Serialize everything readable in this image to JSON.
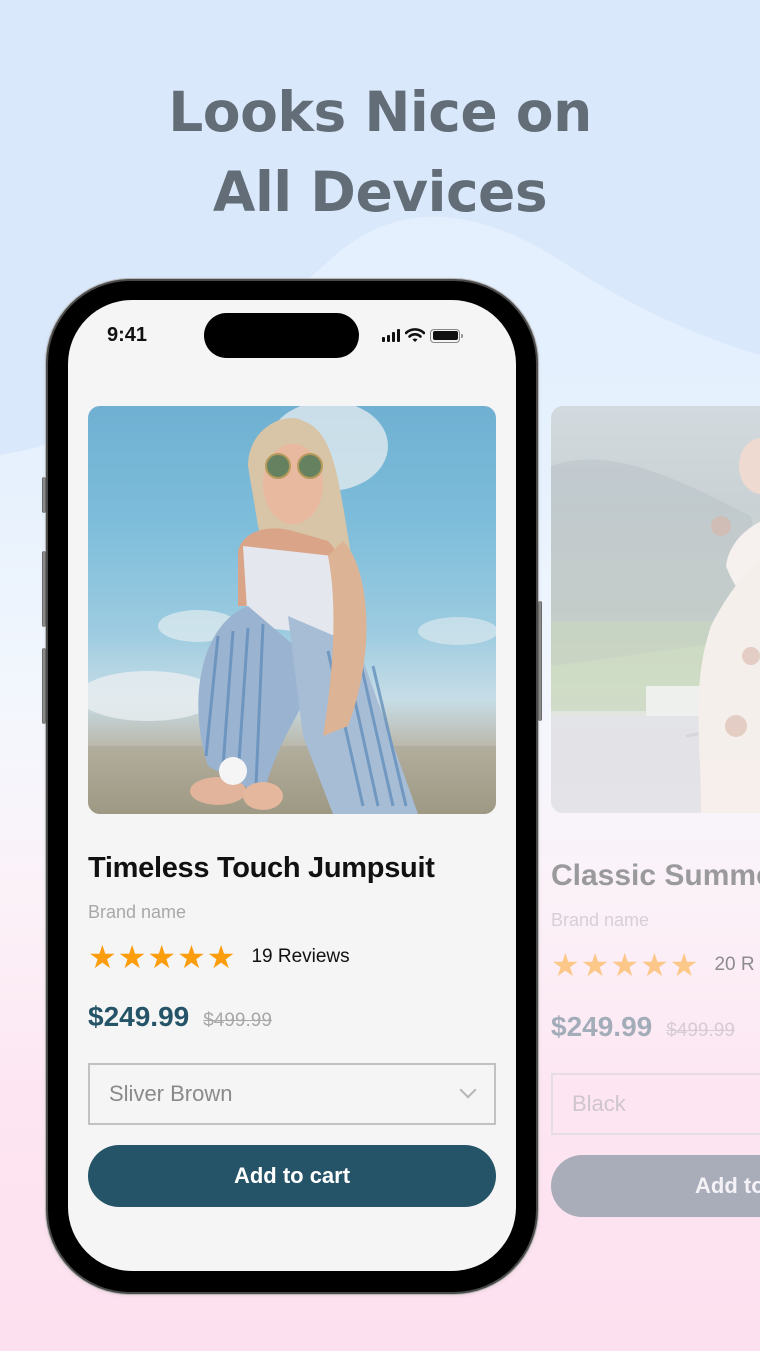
{
  "headline": {
    "line1": "Looks Nice on",
    "line2": "All Devices"
  },
  "status_bar": {
    "time": "9:41",
    "icons": [
      "cellular-signal-icon",
      "wifi-icon",
      "battery-icon"
    ]
  },
  "colors": {
    "accent": "#255367",
    "star": "#fc9d0d",
    "headline": "#636d78",
    "button_disabled": "#a8adb9"
  },
  "products": [
    {
      "image_alt": "Woman with round sunglasses in striped jumpsuit",
      "title": "Timeless Touch Jumpsuit",
      "brand": "Brand name",
      "rating": 5,
      "rating_max": 5,
      "reviews": "19 Reviews",
      "price": "$249.99",
      "old_price": "$499.99",
      "selected_option": "Sliver Brown",
      "cta": "Add to cart"
    },
    {
      "image_alt": "Woman in white floral dress on road",
      "title": "Classic Summe",
      "brand": "Brand name",
      "rating": 5,
      "rating_max": 5,
      "reviews": "20 R",
      "price": "$249.99",
      "old_price": "$499.99",
      "selected_option": "Black",
      "cta": "Add to"
    }
  ]
}
